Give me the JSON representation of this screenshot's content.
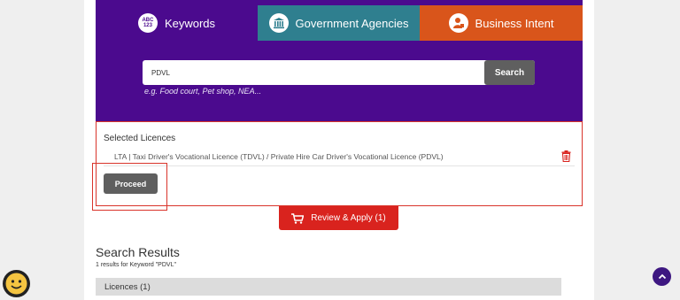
{
  "tabs": [
    {
      "label": "Keywords",
      "icon": "abc-123-icon",
      "icon_text_top": "ABC",
      "icon_text_bottom": "123"
    },
    {
      "label": "Government Agencies",
      "icon": "government-building-icon"
    },
    {
      "label": "Business Intent",
      "icon": "business-person-icon"
    }
  ],
  "search": {
    "value": "PDVL",
    "button_label": "Search",
    "hint": "e.g. Food court, Pet shop, NEA..."
  },
  "selected": {
    "title": "Selected Licences",
    "licences": [
      {
        "text": "LTA | Taxi Driver's Vocational Licence (TDVL) / Private Hire Car Driver's Vocational Licence (PDVL)",
        "icon": "trash-icon"
      }
    ],
    "proceed_label": "Proceed"
  },
  "review": {
    "label": "Review & Apply (1)",
    "icon": "cart-icon"
  },
  "results": {
    "title": "Search Results",
    "count": "1 results for Keyword \"PDVL\"",
    "section_label": "Licences (1)"
  },
  "colors": {
    "panel_purple": "#4b0a8e",
    "tab_teal": "#2f7f8f",
    "tab_orange": "#d9551b",
    "accent_red": "#d9231e",
    "button_gray": "#5f5f5f"
  },
  "floating": {
    "chat_icon": "smiley-face-icon",
    "scroll_icon": "chevron-up-icon"
  }
}
